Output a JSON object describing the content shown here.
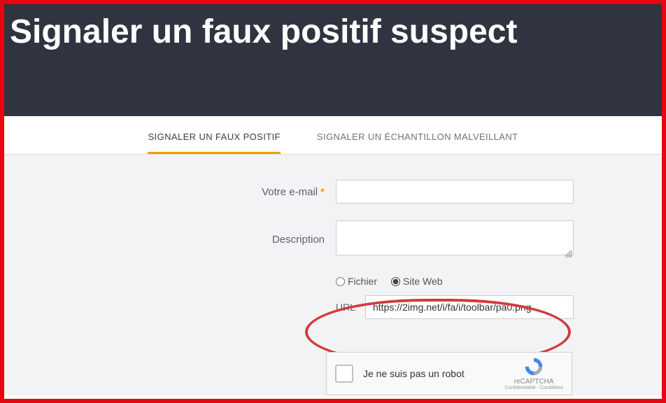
{
  "header": {
    "title": "Signaler un faux positif suspect"
  },
  "tabs": {
    "fp": "SIGNALER UN FAUX POSITIF",
    "mal": "SIGNALER UN ÉCHANTILLON MALVEILLANT"
  },
  "form": {
    "email_label": "Votre e-mail",
    "email_value": "",
    "description_label": "Description",
    "description_value": "",
    "radio_file": "Fichier",
    "radio_site": "Site Web",
    "url_label": "URL",
    "url_value": "https://2img.net/i/fa/i/toolbar/pa0.png"
  },
  "recaptcha": {
    "text": "Je ne suis pas un robot",
    "brand": "reCAPTCHA",
    "terms": "Confidentialité - Conditions"
  }
}
